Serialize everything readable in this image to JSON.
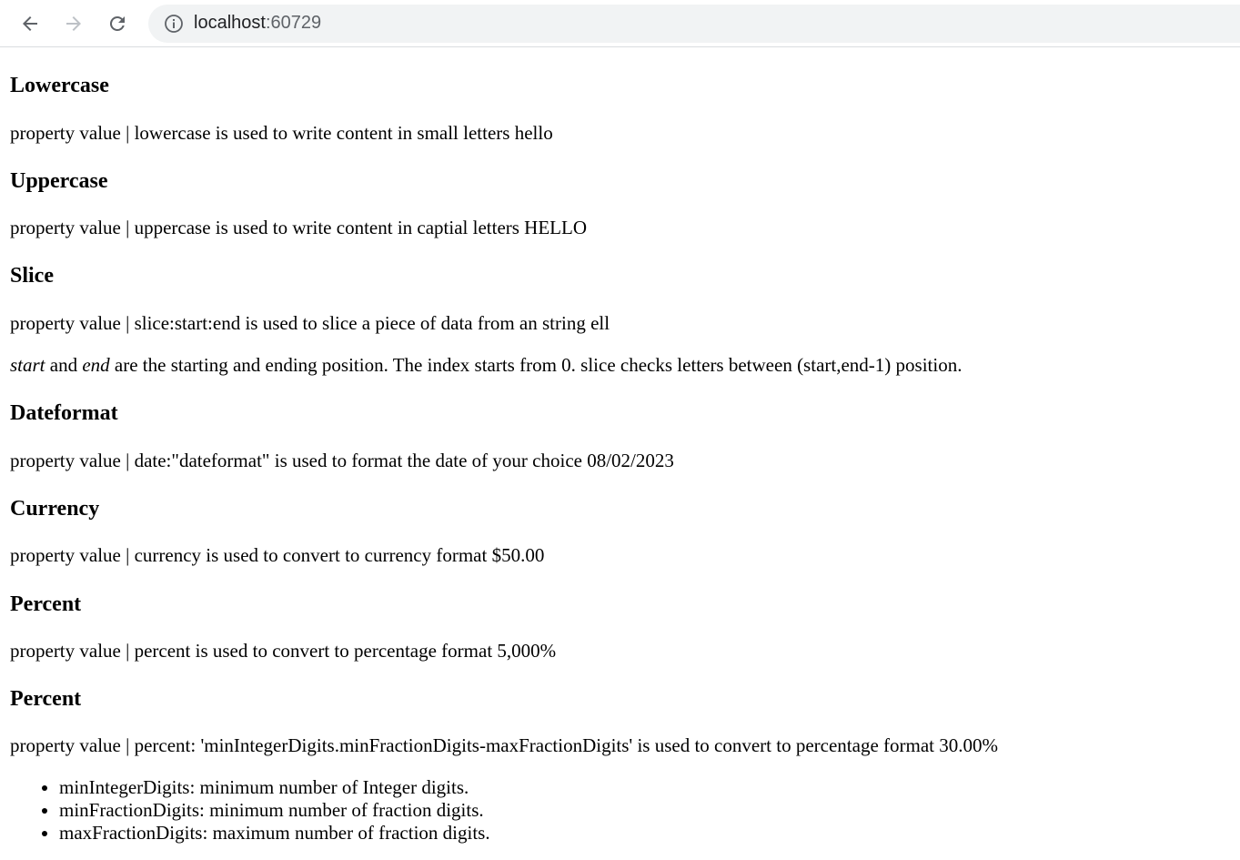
{
  "browser": {
    "url_host": "localhost",
    "url_port": ":60729"
  },
  "sections": [
    {
      "heading": "Lowercase",
      "text": "property value | lowercase is used to write content in small letters hello"
    },
    {
      "heading": "Uppercase",
      "text": "property value | uppercase is used to write content in captial letters HELLO"
    },
    {
      "heading": "Slice",
      "text": "property value | slice:start:end is used to slice a piece of data from an string ell"
    },
    {
      "heading": "Dateformat",
      "text": "property value | date:\"dateformat\" is used to format the date of your choice 08/02/2023"
    },
    {
      "heading": "Currency",
      "text": "property value | currency is used to convert to currency format $50.00"
    },
    {
      "heading": "Percent",
      "text": "property value | percent is used to convert to percentage format 5,000%"
    },
    {
      "heading": "Percent",
      "text": "property value | percent: 'minIntegerDigits.minFractionDigits-maxFractionDigits' is used to convert to percentage format 30.00%"
    }
  ],
  "slice_note": {
    "start": "start",
    "and": " and ",
    "end": "end",
    "rest": " are the starting and ending position. The index starts from 0. slice checks letters between (start,end-1) position."
  },
  "percent_list": [
    "minIntegerDigits: minimum number of Integer digits.",
    "minFractionDigits: minimum number of fraction digits.",
    "maxFractionDigits: maximum number of fraction digits."
  ]
}
